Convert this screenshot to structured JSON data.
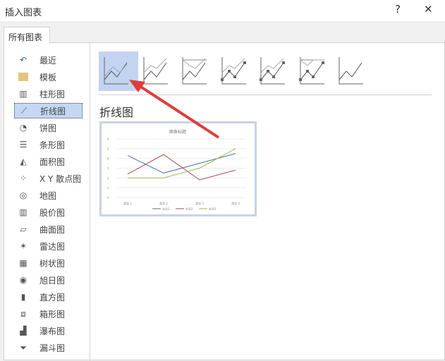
{
  "dialog": {
    "title": "插入图表",
    "help": "?",
    "close": "✕"
  },
  "tabs": [
    {
      "label": "所有图表"
    }
  ],
  "sidebar": {
    "items": [
      {
        "label": "最近",
        "icon": "undo-icon"
      },
      {
        "label": "模板",
        "icon": "folder-icon"
      },
      {
        "label": "柱形图",
        "icon": "column-chart-icon"
      },
      {
        "label": "折线图",
        "icon": "line-chart-icon",
        "selected": true
      },
      {
        "label": "饼图",
        "icon": "pie-chart-icon"
      },
      {
        "label": "条形图",
        "icon": "bar-chart-icon"
      },
      {
        "label": "面积图",
        "icon": "area-chart-icon"
      },
      {
        "label": "X Y 散点图",
        "icon": "scatter-chart-icon"
      },
      {
        "label": "地图",
        "icon": "map-chart-icon"
      },
      {
        "label": "股价图",
        "icon": "stock-chart-icon"
      },
      {
        "label": "曲面图",
        "icon": "surface-chart-icon"
      },
      {
        "label": "雷达图",
        "icon": "radar-chart-icon"
      },
      {
        "label": "树状图",
        "icon": "treemap-icon"
      },
      {
        "label": "旭日图",
        "icon": "sunburst-icon"
      },
      {
        "label": "直方图",
        "icon": "histogram-icon"
      },
      {
        "label": "箱形图",
        "icon": "box-whisker-icon"
      },
      {
        "label": "瀑布图",
        "icon": "waterfall-icon"
      },
      {
        "label": "漏斗图",
        "icon": "funnel-icon"
      }
    ]
  },
  "main": {
    "heading": "折线图"
  },
  "accent": "#c2d4ef",
  "arrow_color": "#e03c3c",
  "chart_data": {
    "type": "line",
    "title": "图表标题",
    "categories": [
      "类别 1",
      "类别 2",
      "类别 3",
      "类别 4"
    ],
    "series": [
      {
        "name": "系列1",
        "values": [
          4.3,
          2.5,
          3.5,
          4.5
        ],
        "color": "#4f6fa0"
      },
      {
        "name": "系列2",
        "values": [
          2.4,
          4.4,
          1.8,
          2.8
        ],
        "color": "#b0474f"
      },
      {
        "name": "系列3",
        "values": [
          2,
          2,
          3,
          5
        ],
        "color": "#9bbb59"
      }
    ],
    "ylim": [
      0,
      6
    ],
    "yticks": [
      "0",
      "1",
      "2",
      "3",
      "4",
      "5",
      "6"
    ],
    "legend": "bottom"
  }
}
